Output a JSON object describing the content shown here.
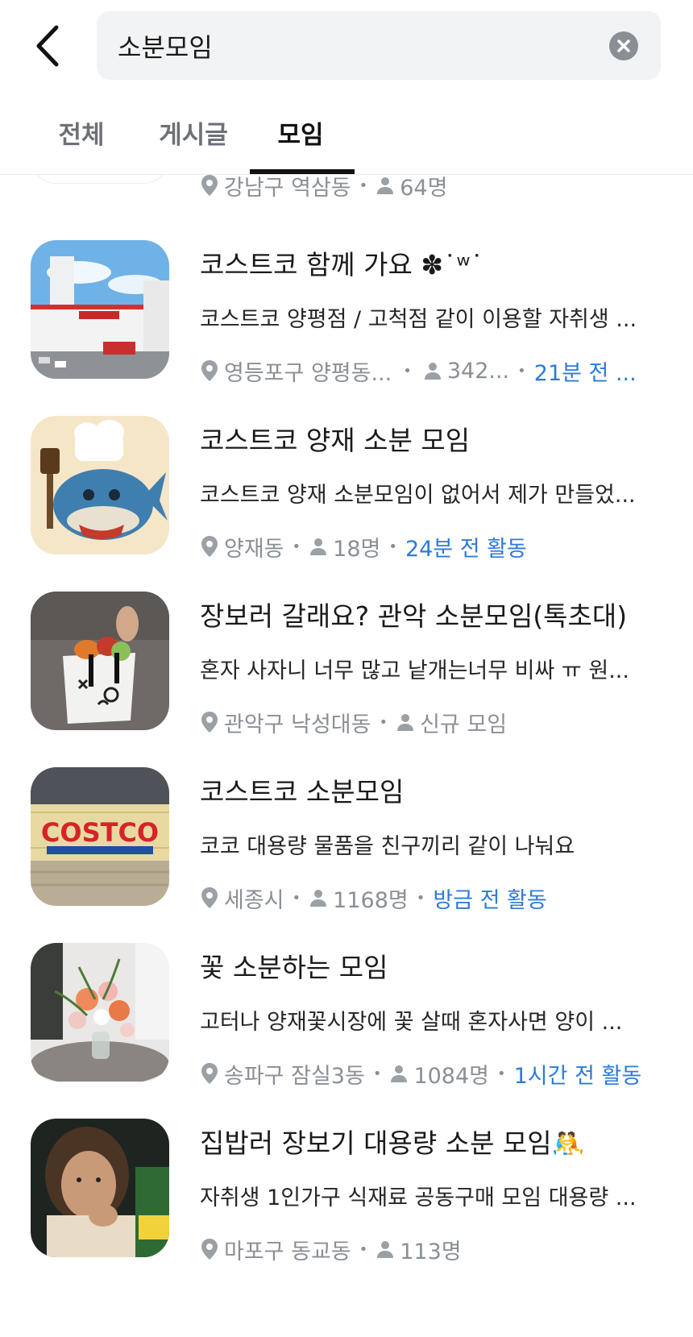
{
  "search": {
    "query": "소분모임"
  },
  "tabs": [
    {
      "label": "전체"
    },
    {
      "label": "게시글"
    },
    {
      "label": "모임"
    }
  ],
  "partial_item": {
    "location": "강남구 역삼동",
    "members": "64명"
  },
  "items": [
    {
      "title": "코스트코 함께 가요 ✽˙ʷ˙",
      "description": "코스트코 양평점 / 고척점 같이 이용할 자취생 ...",
      "location": "영등포구 양평동...",
      "members": "342...",
      "activity": "21분 전 ..."
    },
    {
      "title": "코스트코 양재 소분 모임",
      "description": "코스트코 양재 소분모임이 없어서 제가 만들었...",
      "location": "양재동",
      "members": "18명",
      "activity": "24분 전 활동"
    },
    {
      "title": "장보러 갈래요? 관악 소분모임(톡초대)",
      "description": "혼자 사자니 너무 많고 낱개는너무 비싸 ㅠ 원...",
      "location": "관악구 낙성대동",
      "members": "신규 모임",
      "activity": ""
    },
    {
      "title": "코스트코 소분모임",
      "description": "코코 대용량 물품을 친구끼리 같이 나눠요",
      "location": "세종시",
      "members": "1168명",
      "activity": "방금 전 활동",
      "thumb_text": "COSTCO"
    },
    {
      "title": "꽃 소분하는 모임",
      "description": "고터나 양재꽃시장에 꽃 살때 혼자사면 양이 ...",
      "location": "송파구 잠실3동",
      "members": "1084명",
      "activity": "1시간 전 활동"
    },
    {
      "title": "집밥러 장보기 대용량 소분 모임🤼",
      "description": "자취생 1인가구 식재료 공동구매 모임 대용량 ...",
      "location": "마포구 동교동",
      "members": "113명",
      "activity": ""
    }
  ],
  "colors": {
    "accent": "#2e7bd6",
    "muted": "#8a8f96",
    "search_bg": "#f2f3f5"
  }
}
